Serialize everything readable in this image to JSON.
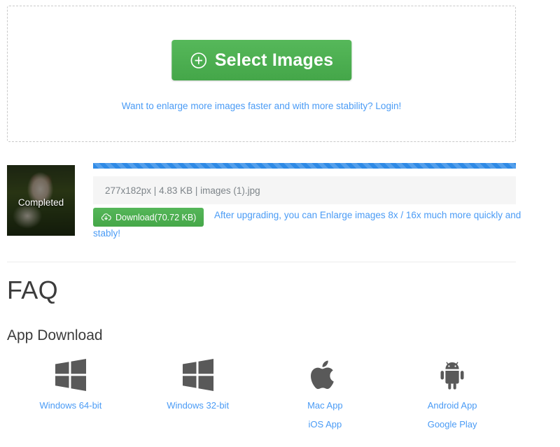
{
  "uploader": {
    "select_button_label": "Select Images",
    "select_button_icon": "plus-circle-icon",
    "login_prompt": "Want to enlarge more images faster and with more stability? Login!",
    "accent_color": "#4caf50",
    "link_color": "#4a9bf5"
  },
  "result": {
    "status_label": "Completed",
    "progress_percent": 100,
    "progress_color": "#2e8ae6",
    "file_info": "277x182px | 4.83 KB | images (1).jpg",
    "dimensions": "277x182px",
    "original_size": "4.83 KB",
    "filename": "images (1).jpg",
    "download_label": "Download(70.72 KB)",
    "download_size": "70.72 KB",
    "download_icon": "cloud-download-icon",
    "upgrade_note": "After upgrading, you can Enlarge images 8x / 16x much more quickly and stably!"
  },
  "faq": {
    "heading": "FAQ",
    "section_heading": "App Download"
  },
  "apps": [
    {
      "icon": "windows-logo-icon",
      "links": [
        {
          "label": "Windows 64-bit"
        }
      ]
    },
    {
      "icon": "windows-logo-icon",
      "links": [
        {
          "label": "Windows 32-bit"
        }
      ]
    },
    {
      "icon": "apple-logo-icon",
      "links": [
        {
          "label": "Mac App"
        },
        {
          "label": "iOS App"
        }
      ]
    },
    {
      "icon": "android-logo-icon",
      "links": [
        {
          "label": "Android App"
        },
        {
          "label": "Google Play"
        }
      ]
    }
  ]
}
